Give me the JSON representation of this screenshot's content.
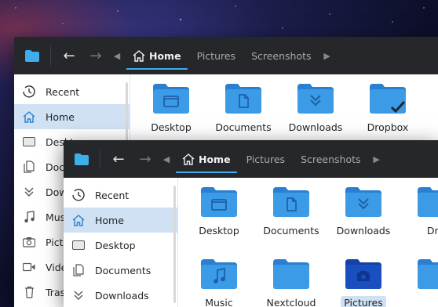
{
  "colors": {
    "toolbar_bg": "#26272b",
    "accent": "#3daee9",
    "folder_body": "#3b9be6",
    "folder_tab": "#2a7fd0",
    "folder_selected": "#1a4fbf",
    "sidebar_active": "#cfe1f3"
  },
  "back_window": {
    "breadcrumbs": [
      "Home",
      "Pictures",
      "Screenshots"
    ],
    "sidebar": [
      {
        "label": "Recent",
        "icon": "clock-icon"
      },
      {
        "label": "Home",
        "icon": "home-icon",
        "active": true
      },
      {
        "label": "Desktop",
        "icon": "desktop-icon"
      },
      {
        "label": "Documents",
        "icon": "documents-icon"
      },
      {
        "label": "Downloads",
        "icon": "downloads-icon"
      },
      {
        "label": "Music",
        "icon": "music-icon"
      },
      {
        "label": "Pictures",
        "icon": "camera-icon"
      },
      {
        "label": "Videos",
        "icon": "video-icon"
      },
      {
        "label": "Trash",
        "icon": "trash-icon"
      }
    ],
    "files": [
      {
        "label": "Desktop",
        "icon": "desktop-folder-icon"
      },
      {
        "label": "Documents",
        "icon": "documents-folder-icon"
      },
      {
        "label": "Downloads",
        "icon": "downloads-folder-icon"
      },
      {
        "label": "Dropbox",
        "icon": "dropbox-folder-icon"
      }
    ]
  },
  "front_window": {
    "breadcrumbs": [
      "Home",
      "Pictures",
      "Screenshots"
    ],
    "sidebar": [
      {
        "label": "Recent",
        "icon": "clock-icon"
      },
      {
        "label": "Home",
        "icon": "home-icon",
        "active": true
      },
      {
        "label": "Desktop",
        "icon": "desktop-icon"
      },
      {
        "label": "Documents",
        "icon": "documents-icon"
      },
      {
        "label": "Downloads",
        "icon": "downloads-icon"
      }
    ],
    "files": [
      {
        "label": "Desktop",
        "icon": "desktop-folder-icon"
      },
      {
        "label": "Documents",
        "icon": "documents-folder-icon"
      },
      {
        "label": "Downloads",
        "icon": "downloads-folder-icon"
      },
      {
        "label": "Dro",
        "icon": "folder-icon"
      },
      {
        "label": "Music",
        "icon": "music-folder-icon"
      },
      {
        "label": "Nextcloud",
        "icon": "nextcloud-folder-icon"
      },
      {
        "label": "Pictures",
        "icon": "pictures-folder-icon",
        "selected": true
      },
      {
        "label": "",
        "icon": "folder-icon"
      }
    ]
  }
}
